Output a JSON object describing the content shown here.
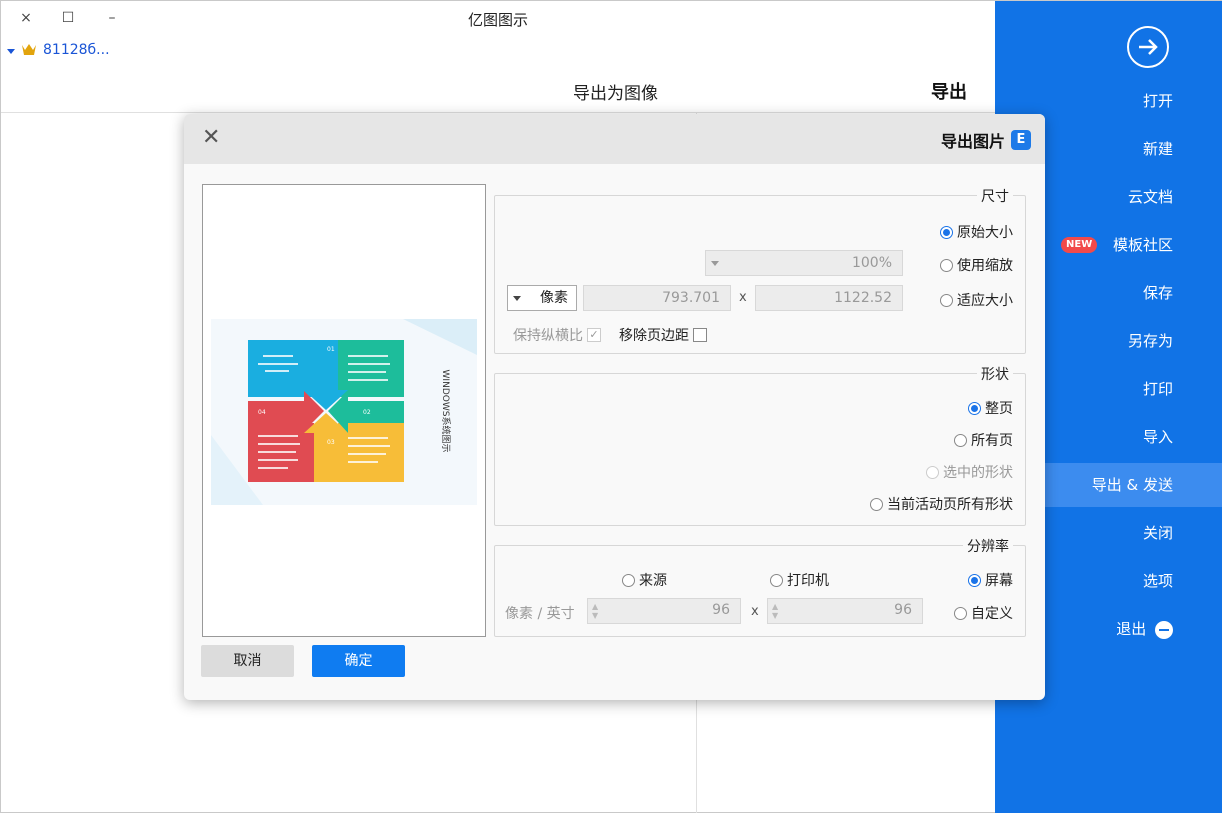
{
  "window": {
    "title": "亿图图示",
    "close_icon": "×",
    "maximize_icon": "☐",
    "minimize_icon": "–"
  },
  "account": {
    "name": "81128б..."
  },
  "header": {
    "section_title": "导出",
    "page_title": "导出为图像"
  },
  "sidebar": {
    "items": [
      {
        "label": "打开"
      },
      {
        "label": "新建"
      },
      {
        "label": "云文档"
      },
      {
        "label": "模板社区",
        "badge": "NEW"
      },
      {
        "label": "保存"
      },
      {
        "label": "另存为"
      },
      {
        "label": "打印"
      },
      {
        "label": "导入"
      },
      {
        "label": "导出 & 发送"
      },
      {
        "label": "关闭"
      },
      {
        "label": "选项"
      },
      {
        "label": "退出"
      }
    ]
  },
  "dialog": {
    "title": "导出图片",
    "logo": "E",
    "size": {
      "title": "尺寸",
      "original": "原始大小",
      "zoom": "使用缩放",
      "zoom_value": "100%",
      "fit": "适应大小",
      "width": "1122.52",
      "height": "793.701",
      "times": "x",
      "unit": "像素",
      "remove_margin": "移除页边距",
      "keep_ratio": "保持纵横比",
      "keep_ratio_check": "✓"
    },
    "shape": {
      "title": "形状",
      "whole_page": "整页",
      "all_pages": "所有页",
      "selected": "选中的形状",
      "current_active": "当前活动页所有形状"
    },
    "resolution": {
      "title": "分辨率",
      "screen": "屏幕",
      "printer": "打印机",
      "source": "来源",
      "custom": "自定义",
      "x_value": "96",
      "y_value": "96",
      "times": "x",
      "unit": "像素 / 英寸",
      "spin_up": "▲",
      "spin_down": "▼"
    },
    "preview": {
      "heading": "WINDOWS系统图示",
      "tiles": [
        "01",
        "02",
        "03",
        "04"
      ]
    },
    "ok_label": "确定",
    "cancel_label": "取消"
  },
  "colors": {
    "sidebar": "#1173e6",
    "accent": "#0f7cf1",
    "badge": "#f24a4a",
    "tile_blue": "#1aaee0",
    "tile_green": "#1dbd9b",
    "tile_red": "#e04b52",
    "tile_yellow": "#f7bd38"
  }
}
